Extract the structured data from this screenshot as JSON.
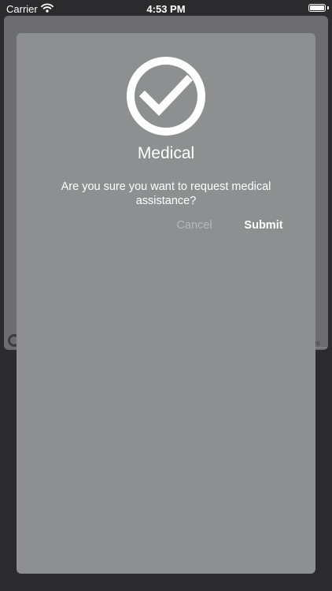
{
  "status_bar": {
    "carrier": "Carrier",
    "time": "4:53 PM"
  },
  "backdrop": {
    "legal_text": "es"
  },
  "dialog": {
    "icon": "checkmark-circle-icon",
    "title": "Medical",
    "message": "Are you sure you want to request medical assistance?",
    "cancel_label": "Cancel",
    "submit_label": "Submit"
  },
  "colors": {
    "page_background": "#2b2b2d",
    "modal_background": "#8e8f91",
    "text_primary": "#ffffff",
    "text_disabled": "#b7b8ba"
  }
}
